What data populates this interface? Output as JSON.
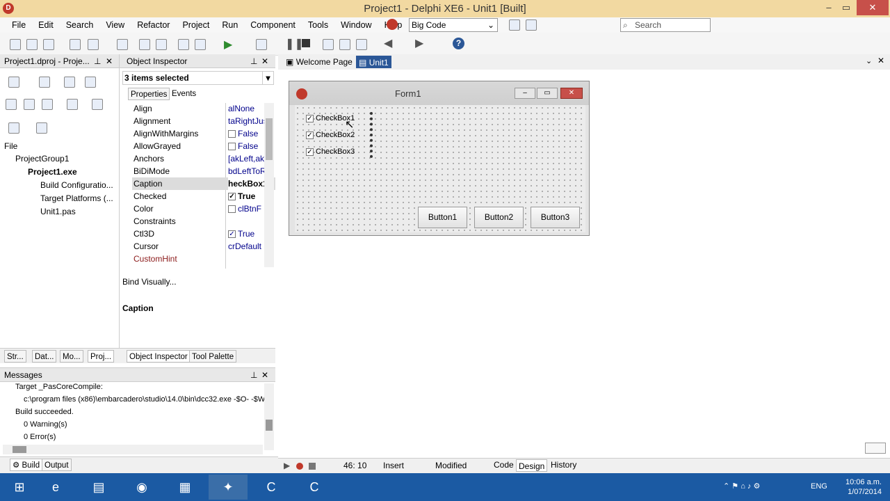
{
  "window": {
    "title": "Project1 - Delphi XE6 - Unit1 [Built]",
    "min": "–",
    "max": "▭",
    "close": "✕"
  },
  "menu": [
    "File",
    "Edit",
    "Search",
    "View",
    "Refactor",
    "Project",
    "Run",
    "Component",
    "Tools",
    "Window",
    "Help"
  ],
  "toolbar": {
    "layout_combo": "Big Code",
    "search_placeholder": "Search"
  },
  "project_panel": {
    "title": "Project1.dproj - Proje...",
    "file_label": "File",
    "tree": [
      "ProjectGroup1",
      "Project1.exe",
      "Build Configuratio...",
      "Target Platforms (...",
      "Unit1.pas"
    ]
  },
  "object_inspector": {
    "title": "Object Inspector",
    "selection": "3 items selected",
    "tab_properties": "Properties",
    "tab_events": "Events",
    "properties": [
      {
        "name": "Align",
        "value": "alNone"
      },
      {
        "name": "Alignment",
        "value": "taRightJus"
      },
      {
        "name": "AlignWithMargins",
        "value": "False"
      },
      {
        "name": "AllowGrayed",
        "value": "False"
      },
      {
        "name": "Anchors",
        "value": "[akLeft,ak"
      },
      {
        "name": "BiDiMode",
        "value": "bdLeftToR"
      },
      {
        "name": "Caption",
        "value": "heckBox1"
      },
      {
        "name": "Checked",
        "value": "True"
      },
      {
        "name": "Color",
        "value": "clBtnF"
      },
      {
        "name": "Constraints",
        "value": ""
      },
      {
        "name": "Ctl3D",
        "value": "True"
      },
      {
        "name": "Cursor",
        "value": "crDefault"
      },
      {
        "name": "CustomHint",
        "value": ""
      }
    ],
    "bind_visually": "Bind Visually...",
    "description_title": "Caption"
  },
  "left_tabs": [
    "Str...",
    "Dat...",
    "Mo...",
    "Proj..."
  ],
  "oi_tabs": [
    "Object Inspector",
    "Tool Palette"
  ],
  "messages": {
    "title": "Messages",
    "lines": [
      "Target _PasCoreCompile:",
      "c:\\program files (x86)\\embarcadero\\studio\\14.0\\bin\\dcc32.exe -$O- -$W",
      "Build succeeded.",
      "0 Warning(s)",
      "0 Error(s)"
    ],
    "tab_build": "Build",
    "tab_output": "Output"
  },
  "doc_tabs": [
    "Welcome Page",
    "Unit1"
  ],
  "form": {
    "caption": "Form1",
    "checkboxes": [
      "CheckBox1",
      "CheckBox2",
      "CheckBox3"
    ],
    "buttons": [
      "Button1",
      "Button2",
      "Button3"
    ]
  },
  "status": {
    "position": "46: 10",
    "mode": "Insert",
    "state": "Modified",
    "tabs": [
      "Code",
      "Design",
      "History"
    ]
  },
  "tray": {
    "lang": "ENG",
    "time": "10:06 a.m.",
    "date": "1/07/2014"
  }
}
